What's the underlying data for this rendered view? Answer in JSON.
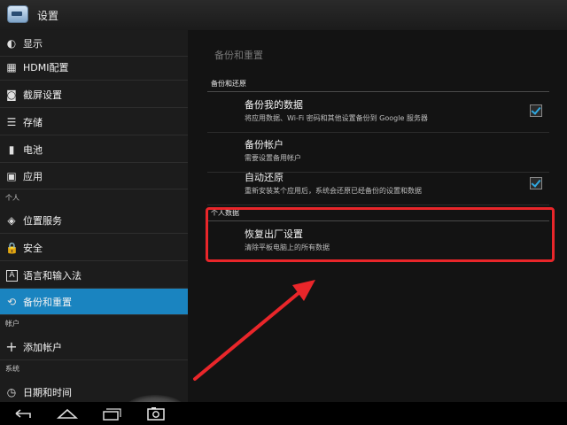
{
  "app": {
    "title": "设置",
    "icon": "settings-app-icon"
  },
  "sidebar": {
    "items": [
      {
        "icon": "display-icon",
        "label": "显示"
      },
      {
        "icon": "hdmi-icon",
        "label": "HDMI配置"
      },
      {
        "icon": "screenshot-icon",
        "label": "截屏设置"
      },
      {
        "icon": "storage-icon",
        "label": "存储"
      },
      {
        "icon": "battery-icon",
        "label": "电池"
      },
      {
        "icon": "apps-icon",
        "label": "应用"
      }
    ],
    "section_personal": "个人",
    "personal_items": [
      {
        "icon": "location-icon",
        "label": "位置服务"
      },
      {
        "icon": "lock-icon",
        "label": "安全"
      },
      {
        "icon": "language-icon",
        "label": "语言和输入法"
      },
      {
        "icon": "backup-icon",
        "label": "备份和重置",
        "active": true
      }
    ],
    "section_accounts": "帐户",
    "accounts_items": [
      {
        "icon": "add-icon",
        "label": "添加帐户"
      }
    ],
    "section_system": "系统",
    "system_items": [
      {
        "icon": "clock-icon",
        "label": "日期和时间"
      }
    ]
  },
  "main": {
    "page_title": "备份和重置",
    "section_backup": "备份和还原",
    "backup_rows": [
      {
        "title": "备份我的数据",
        "subtitle": "将应用数据、Wi-Fi 密码和其他设置备份到 Google 服务器",
        "checked": true
      },
      {
        "title": "备份帐户",
        "subtitle": "需要设置备用帐户",
        "checked": false
      },
      {
        "title": "自动还原",
        "subtitle": "重新安装某个应用后，系统会还原已经备份的设置和数据",
        "checked": true
      }
    ],
    "section_personal_data": "个人数据",
    "personal_rows": [
      {
        "title": "恢复出厂设置",
        "subtitle": "清除平板电脑上的所有数据"
      }
    ]
  },
  "colors": {
    "accent": "#1a84c0",
    "checkmark": "#2fa8e0",
    "highlight": "#e9262a"
  },
  "navbar": {
    "icons": [
      "back-icon",
      "home-icon",
      "recent-apps-icon",
      "camera-icon"
    ]
  }
}
